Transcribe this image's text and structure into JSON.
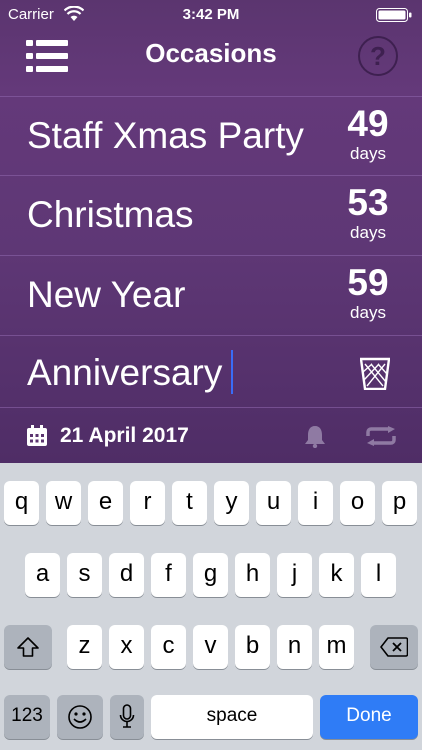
{
  "status_bar": {
    "carrier": "Carrier",
    "time": "3:42 PM"
  },
  "header": {
    "title": "Occasions",
    "help_label": "?"
  },
  "occasions": [
    {
      "name": "Staff Xmas Party",
      "days": "49",
      "unit": "days"
    },
    {
      "name": "Christmas",
      "days": "53",
      "unit": "days"
    },
    {
      "name": "New Year",
      "days": "59",
      "unit": "days"
    }
  ],
  "editing": {
    "value": "Anniversary",
    "date": "21 April 2017"
  },
  "keyboard": {
    "row1": [
      "q",
      "w",
      "e",
      "r",
      "t",
      "y",
      "u",
      "i",
      "o",
      "p"
    ],
    "row2": [
      "a",
      "s",
      "d",
      "f",
      "g",
      "h",
      "j",
      "k",
      "l"
    ],
    "row3": [
      "z",
      "x",
      "c",
      "v",
      "b",
      "n",
      "m"
    ],
    "numbers_label": "123",
    "space_label": "space",
    "done_label": "Done"
  },
  "colors": {
    "accent": "#2f7cf6",
    "background": "#5e3775"
  }
}
